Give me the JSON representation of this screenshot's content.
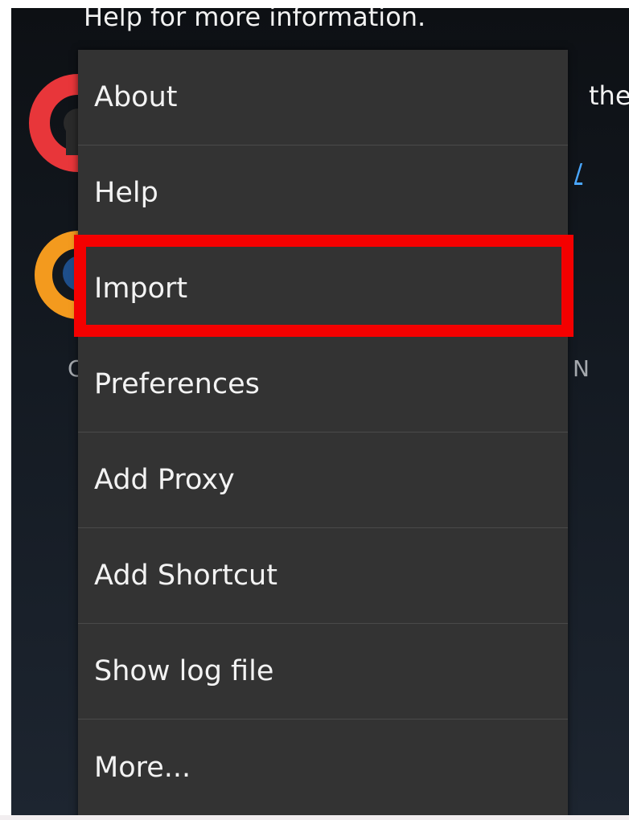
{
  "background": {
    "help_line": "Help for more information.",
    "the_text": "the",
    "link_fragment": "/",
    "n_fragment": "N",
    "c_fragment": "C"
  },
  "menu": {
    "items": [
      {
        "label": "About"
      },
      {
        "label": "Help"
      },
      {
        "label": "Import"
      },
      {
        "label": "Preferences"
      },
      {
        "label": "Add Proxy"
      },
      {
        "label": "Add Shortcut"
      },
      {
        "label": "Show log file"
      },
      {
        "label": "More..."
      }
    ],
    "highlighted_item": "Import"
  },
  "colors": {
    "menu_bg": "#333333",
    "highlight": "#f40000",
    "link": "#4aa7ff",
    "icon_red": "#e8363a",
    "icon_orange": "#f39a1e",
    "icon_blue": "#1e4e8a"
  },
  "icons": {
    "app_icon_1": "red-ring-icon",
    "app_icon_2": "orange-ring-icon"
  }
}
